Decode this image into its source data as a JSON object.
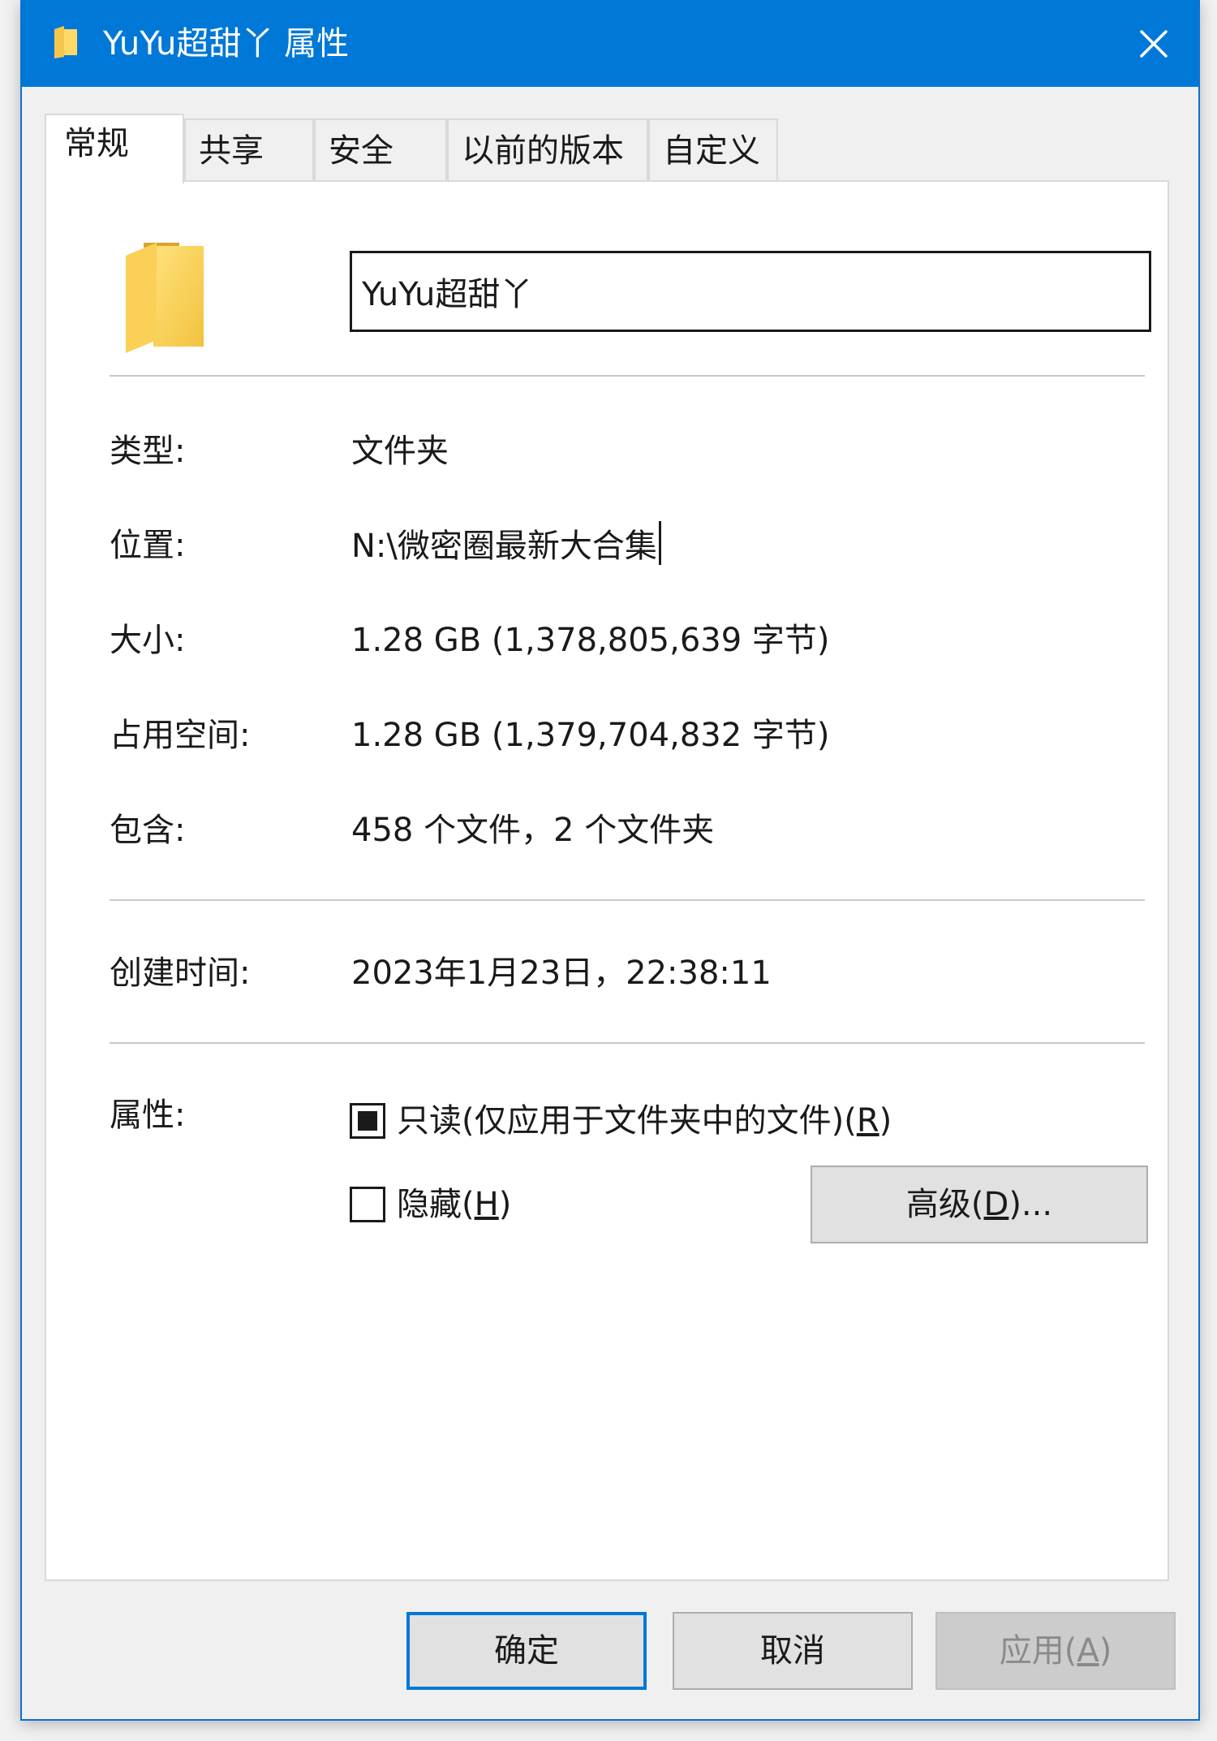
{
  "window": {
    "title": "YuYu超甜丫 属性",
    "title_icon": "folder-icon",
    "close_icon": "close-icon",
    "accent_color": "#0078d7"
  },
  "tabs": [
    {
      "label": "常规",
      "active": true
    },
    {
      "label": "共享",
      "active": false
    },
    {
      "label": "安全",
      "active": false
    },
    {
      "label": "以前的版本",
      "active": false
    },
    {
      "label": "自定义",
      "active": false
    }
  ],
  "general": {
    "folder_icon": "folder-icon",
    "name_value": "YuYu超甜丫",
    "rows": [
      {
        "label": "类型:",
        "value": "文件夹"
      },
      {
        "label": "位置:",
        "value": "N:\\微密圈最新大合集"
      },
      {
        "label": "大小:",
        "value": "1.28 GB (1,378,805,639 字节)"
      },
      {
        "label": "占用空间:",
        "value": "1.28 GB (1,379,704,832 字节)"
      },
      {
        "label": "包含:",
        "value": "458 个文件，2 个文件夹"
      }
    ],
    "created": {
      "label": "创建时间:",
      "value": "2023年1月23日，22:38:11"
    },
    "attributes": {
      "label": "属性:",
      "readonly": {
        "text": "只读(仅应用于文件夹中的文件)(",
        "key": "R",
        "tail": ")",
        "state": "indeterminate"
      },
      "hidden": {
        "text": "隐藏(",
        "key": "H",
        "tail": ")",
        "state": "unchecked"
      },
      "advanced": {
        "text": "高级(",
        "key": "D",
        "tail": ")..."
      }
    }
  },
  "footer": {
    "ok": "确定",
    "cancel": "取消",
    "apply": {
      "text": "应用(",
      "key": "A",
      "tail": ")",
      "enabled": false
    }
  }
}
